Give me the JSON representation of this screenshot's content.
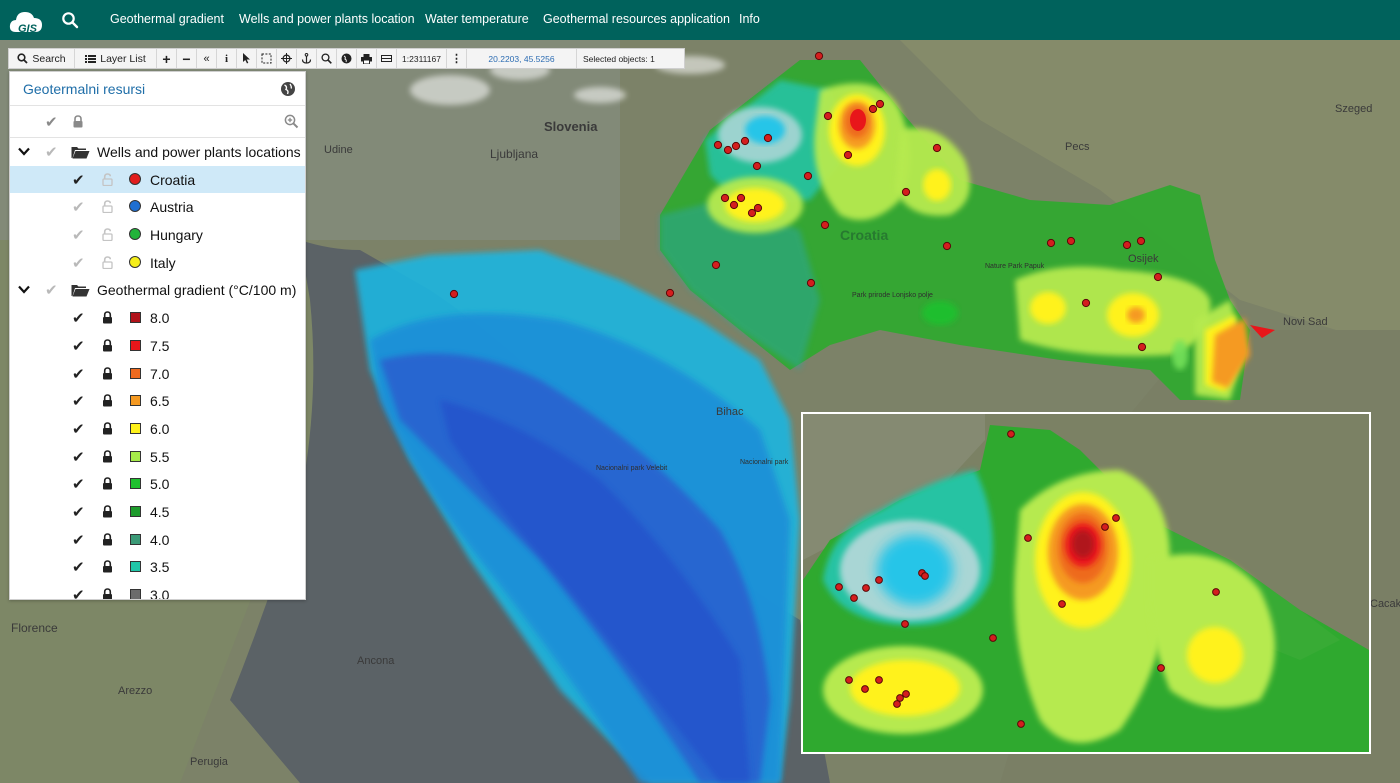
{
  "topnav": {
    "logo_text": "GIS",
    "items": [
      {
        "label": "Geothermal gradient"
      },
      {
        "label": "Wells and power plants location"
      },
      {
        "label": "Water temperature"
      },
      {
        "label": "Geothermal resources application"
      },
      {
        "label": "Info"
      }
    ]
  },
  "toolbar": {
    "search_label": "Search",
    "layerlist_label": "Layer List",
    "scale": "1:2311167",
    "coords": "20.2203, 45.5256",
    "selected": "Selected objects: 1"
  },
  "panel": {
    "title": "Geotermalni resursi",
    "groups": [
      {
        "label": "Wells and power plants locations",
        "items": [
          {
            "label": "Croatia",
            "color": "#e11d1d",
            "selected": true,
            "visible": true
          },
          {
            "label": "Austria",
            "color": "#1f6fd1",
            "selected": false,
            "visible": false
          },
          {
            "label": "Hungary",
            "color": "#22b33a",
            "selected": false,
            "visible": false
          },
          {
            "label": "Italy",
            "color": "#f5ee1a",
            "selected": false,
            "visible": false
          }
        ]
      },
      {
        "label": "Geothermal gradient (°C/100 m)",
        "items": [
          {
            "label": "8.0",
            "color": "#b0121a"
          },
          {
            "label": "7.5",
            "color": "#e8161a"
          },
          {
            "label": "7.0",
            "color": "#ee6a1f"
          },
          {
            "label": "6.5",
            "color": "#f59a22"
          },
          {
            "label": "6.0",
            "color": "#fff21a"
          },
          {
            "label": "5.5",
            "color": "#a6ea4a"
          },
          {
            "label": "5.0",
            "color": "#1fc12f"
          },
          {
            "label": "4.5",
            "color": "#1d9b2c"
          },
          {
            "label": "4.0",
            "color": "#3b9a77"
          },
          {
            "label": "3.5",
            "color": "#21c6a8"
          },
          {
            "label": "3.0",
            "color": "#6b6b6b"
          }
        ]
      }
    ]
  },
  "map_labels": {
    "slovenia": "Slovenia",
    "ljubljana": "Ljubljana",
    "udine": "Udine",
    "croatia": "Croatia",
    "pecs": "Pecs",
    "szeged": "Szeged",
    "osijek": "Osijek",
    "novi_sad": "Novi Sad",
    "bihac": "Bihac",
    "florence": "Florence",
    "ancona": "Ancona",
    "arezzo": "Arezzo",
    "perugia": "Perugia",
    "cacak": "Cacak",
    "park_papuk": "Nature Park Papuk",
    "park_psunj": "Park prirode Lonjsko polje",
    "velebit": "Nacionalni park Velebit",
    "plitvice": "Nacionalni park"
  }
}
